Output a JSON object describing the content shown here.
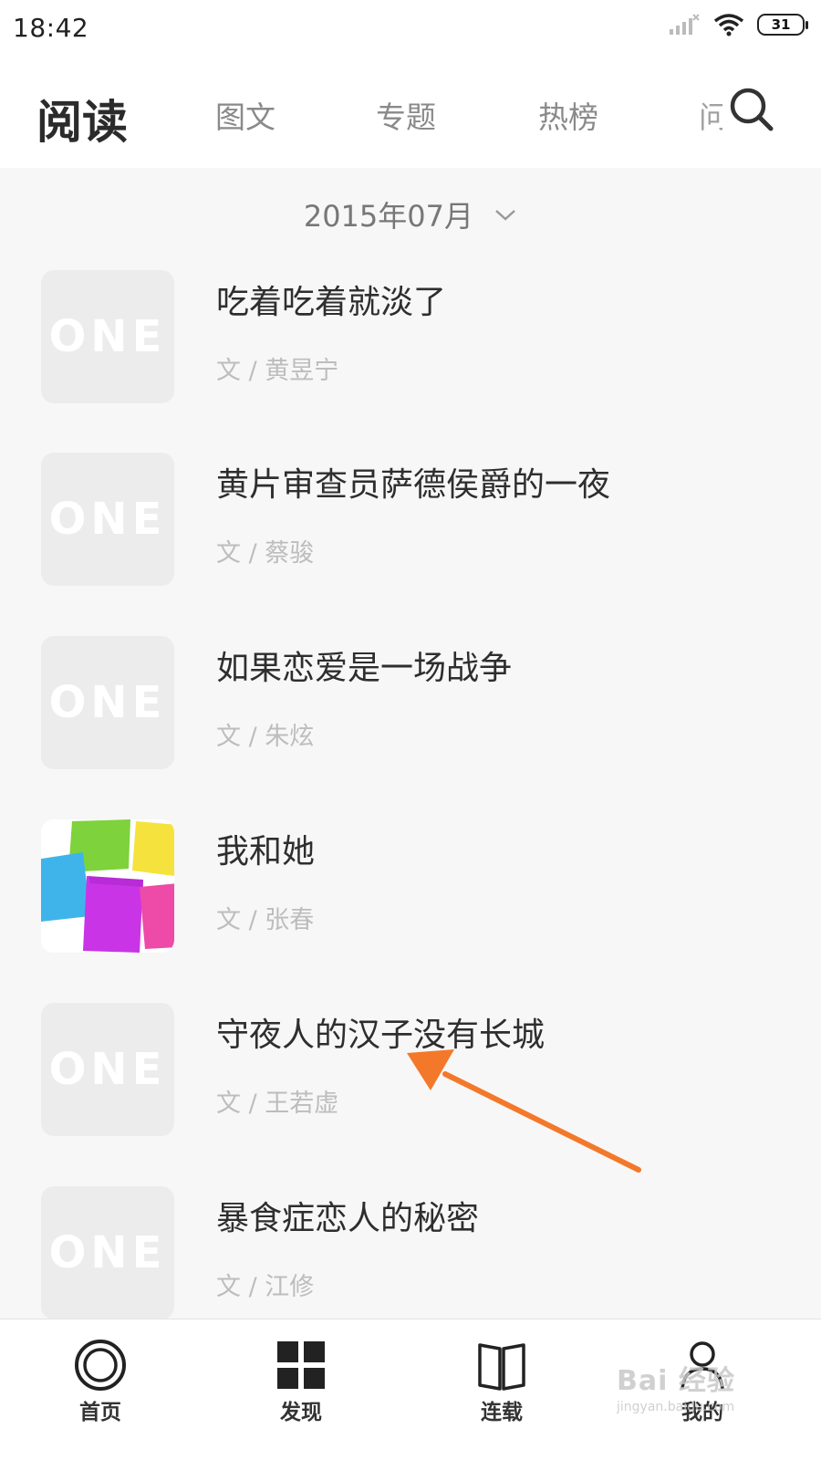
{
  "status_bar": {
    "time": "18:42",
    "battery": "31"
  },
  "header": {
    "title": "阅读",
    "tabs": [
      "图文",
      "专题",
      "热榜",
      "问"
    ]
  },
  "date_filter": {
    "label": "2015年07月"
  },
  "articles": [
    {
      "title": "吃着吃着就淡了",
      "author": "文 / 黄昱宁",
      "thumb_logo": "ONE"
    },
    {
      "title": "黄片审查员萨德侯爵的一夜",
      "author": "文 / 蔡骏",
      "thumb_logo": "ONE"
    },
    {
      "title": "如果恋爱是一场战争",
      "author": "文 / 朱炫",
      "thumb_logo": "ONE"
    },
    {
      "title": "我和她",
      "author": "文 / 张春",
      "thumb_logo": ""
    },
    {
      "title": "守夜人的汉子没有长城",
      "author": "文 / 王若虚",
      "thumb_logo": "ONE"
    },
    {
      "title": "暴食症恋人的秘密",
      "author": "文 / 江修",
      "thumb_logo": "ONE"
    }
  ],
  "tabbar": {
    "items": [
      {
        "label": "首页",
        "icon": "home-icon"
      },
      {
        "label": "发现",
        "icon": "grid-icon"
      },
      {
        "label": "连载",
        "icon": "book-icon"
      },
      {
        "label": "我的",
        "icon": "user-icon"
      }
    ]
  },
  "watermark": {
    "main": "Bai 经验",
    "sub": "jingyan.baidu.com"
  },
  "colors": {
    "accent_arrow": "#f4782a",
    "text_primary": "#2e2e2e",
    "text_secondary": "#bdbdbd",
    "tab_inactive": "#8a8a8a"
  }
}
